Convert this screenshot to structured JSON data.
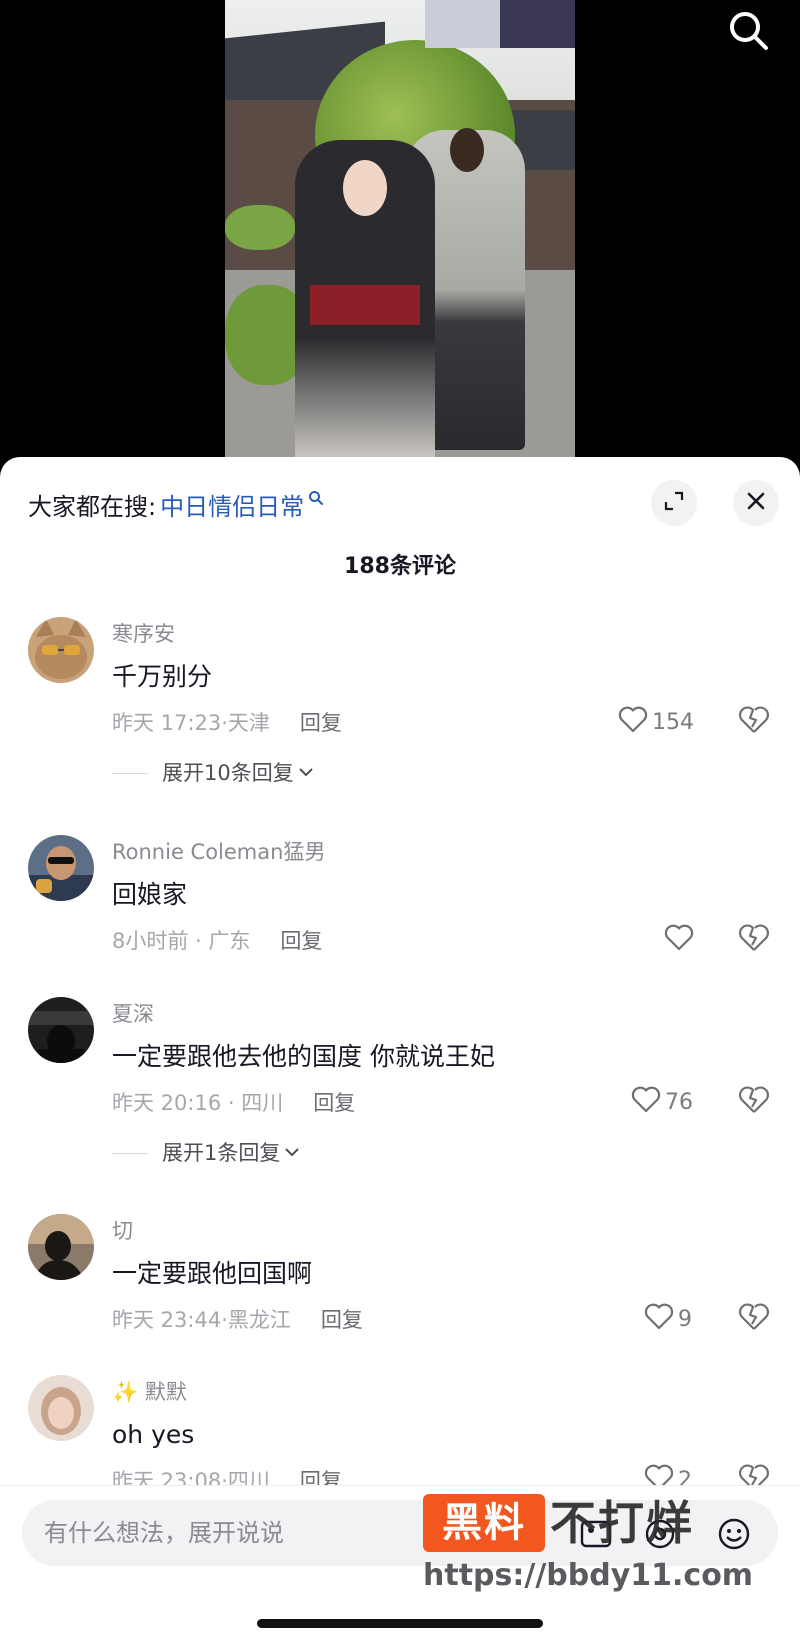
{
  "hot_search": {
    "prefix": "大家都在搜:",
    "term": "中日情侣日常"
  },
  "comment_count": "188条评论",
  "comments": [
    {
      "name": "寒序安",
      "text": "千万别分",
      "time": "昨天 17:23",
      "location": "天津",
      "reply": "回复",
      "likes": "154",
      "expand": "展开10条回复"
    },
    {
      "name": "Ronnie Coleman猛男",
      "text": "回娘家",
      "time": "8小时前",
      "location": "广东",
      "reply": "回复",
      "likes": ""
    },
    {
      "name": "夏深",
      "text": "一定要跟他去他的国度 你就说王妃",
      "time": "昨天 20:16",
      "location": "四川",
      "reply": "回复",
      "likes": "76",
      "expand": "展开1条回复"
    },
    {
      "name": "切",
      "text": "一定要跟他回国啊",
      "time": "昨天 23:44",
      "location": "黑龙江",
      "reply": "回复",
      "likes": "9"
    },
    {
      "name": "✨ 默默",
      "text": "oh yes",
      "time": "昨天 23:08",
      "location": "四川",
      "reply": "回复",
      "likes": "2"
    }
  ],
  "input": {
    "placeholder": "有什么想法，展开说说"
  },
  "watermark": {
    "box": "黑料",
    "text": "不打烊",
    "url": "https://bbdy11.com"
  },
  "colors": {
    "accent_link": "#2a5bb8",
    "watermark_orange": "#f2571f"
  }
}
